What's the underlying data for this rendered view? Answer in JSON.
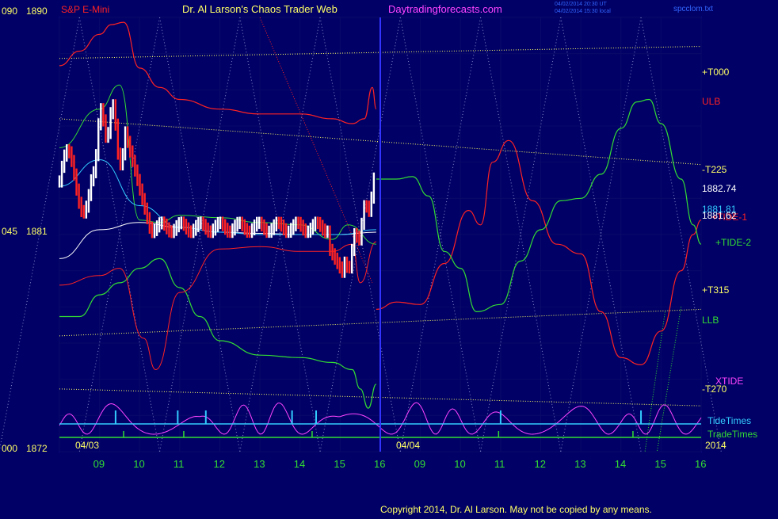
{
  "header": {
    "symbol": "S&P E-Mini",
    "author": "Dr. Al Larson's Chaos Trader Web",
    "site": "Daytradingforecasts.com",
    "time_utc": "04/02/2014 20:30 UT",
    "time_local": "04/02/2014 15:30 local",
    "file": "spcclom.txt"
  },
  "footer": {
    "copyright": "Copyright 2014, Dr. Al Larson. May not be copied by any means."
  },
  "y_axis": {
    "top": {
      "prefix": "090",
      "price": "1890"
    },
    "mid": {
      "prefix": "045",
      "price": "1881"
    },
    "bottom": {
      "prefix": "000",
      "price": "1872"
    }
  },
  "date_labels": {
    "left": "04/03",
    "right": "04/04",
    "year": "2014"
  },
  "right_labels": {
    "t000": "+T000",
    "ulb": "ULB",
    "t225": "-T225",
    "price1": "1882.74",
    "price2": "1881.81",
    "price3": "1881.62",
    "tide1": "+TIDE-1",
    "tide2": "+TIDE-2",
    "t315": "+T315",
    "llb": "LLB",
    "t270": "-T270",
    "xtide": "XTIDE",
    "tidetimes": "TideTimes",
    "tradetimes": "TradeTimes"
  },
  "colors": {
    "background": "#000066",
    "grid": "#0a0a66",
    "axis": "#2d38ff",
    "yellow": "#ffff66",
    "green": "#33dd33",
    "red": "#ff2222",
    "cyan": "#33ccff",
    "magenta": "#ff44ff",
    "white": "#ffffff",
    "divider": "#3333ff"
  },
  "chart_data": {
    "type": "line",
    "title": "S&P E-Mini",
    "ylim": [
      1872,
      1890
    ],
    "x_tick_labels": [
      "09",
      "10",
      "11",
      "12",
      "13",
      "14",
      "15",
      "16",
      "09",
      "10",
      "11",
      "12",
      "13",
      "14",
      "15",
      "16"
    ],
    "price_labels": [
      1882.74,
      1881.81,
      1881.62
    ],
    "series": [
      {
        "name": "ULB",
        "color": "#ff2222",
        "x": [
          0,
          0.5,
          1,
          1.3,
          1.6,
          2,
          2.5,
          3,
          4,
          5,
          6,
          6.8,
          7.3,
          7.6,
          7.8,
          7.9
        ],
        "y": [
          1888,
          1888.6,
          1889.3,
          1889.7,
          1889.8,
          1887.9,
          1887.1,
          1886.6,
          1886.2,
          1886,
          1886,
          1885.8,
          1885.6,
          1885.8,
          1887.1,
          1886.2
        ]
      },
      {
        "name": "LLB",
        "color": "#33dd33",
        "x": [
          0,
          0.5,
          1,
          1.5,
          2,
          2.5,
          3,
          3.5,
          4,
          5,
          6,
          6.8,
          7.3,
          7.5,
          7.7,
          7.9
        ],
        "y": [
          1877.6,
          1877.6,
          1878.5,
          1879,
          1879.6,
          1880,
          1878.8,
          1877.6,
          1876.6,
          1876,
          1875.9,
          1875.7,
          1875.4,
          1874.6,
          1873.8,
          1874.8
        ]
      },
      {
        "name": "+TIDE-1",
        "color": "#ff2222",
        "x": [
          7.9,
          8.4,
          9,
          9.6,
          10.2,
          10.5,
          10.8,
          11.2,
          11.8,
          12.4,
          13,
          13.5,
          14,
          14.5,
          15,
          15.5,
          15.8,
          16
        ],
        "y": [
          1877.9,
          1878.2,
          1878.1,
          1879.8,
          1882,
          1881.4,
          1884,
          1884.9,
          1882.4,
          1880.6,
          1880.2,
          1877.8,
          1875.9,
          1875.6,
          1877,
          1879.5,
          1881,
          1881.6
        ]
      },
      {
        "name": "+TIDE-2",
        "color": "#33dd33",
        "x": [
          7.9,
          8.4,
          8.8,
          9.2,
          9.6,
          10,
          10.4,
          11,
          11.5,
          12,
          12.5,
          13,
          13.5,
          14,
          14.4,
          14.7,
          15,
          15.5,
          15.8,
          16
        ],
        "y": [
          1883.3,
          1883.3,
          1883.4,
          1882.6,
          1880.3,
          1879.6,
          1877.8,
          1878.1,
          1879.9,
          1881.2,
          1882.4,
          1882.5,
          1883.5,
          1885.4,
          1886.5,
          1886.6,
          1885.6,
          1883.3,
          1881.4,
          1880.6
        ]
      },
      {
        "name": "XTIDE",
        "color": "#ff44ff",
        "x": [
          0,
          1,
          2,
          3,
          4,
          5,
          6,
          7,
          8,
          9,
          10,
          11,
          12,
          13,
          14,
          15,
          16
        ],
        "y": [
          0.3,
          0.6,
          0.5,
          0.35,
          0.45,
          0.4,
          0.55,
          0.9,
          0.4,
          0.3,
          0.6,
          0.7,
          0.3,
          0.2,
          0.8,
          0.6,
          0.9
        ]
      }
    ],
    "levels": [
      {
        "name": "+T000",
        "color": "#ffff66",
        "y": [
          1888.3,
          1888.8
        ]
      },
      {
        "name": "-T225",
        "color": "#ffff66",
        "y": [
          1885.8,
          1883.9
        ]
      },
      {
        "name": "+T315",
        "color": "#ffff66",
        "y": [
          1876.8,
          1877.9
        ]
      },
      {
        "name": "-T270",
        "color": "#ffff66",
        "y": [
          1874.6,
          1873.9
        ]
      }
    ],
    "grid": true
  }
}
